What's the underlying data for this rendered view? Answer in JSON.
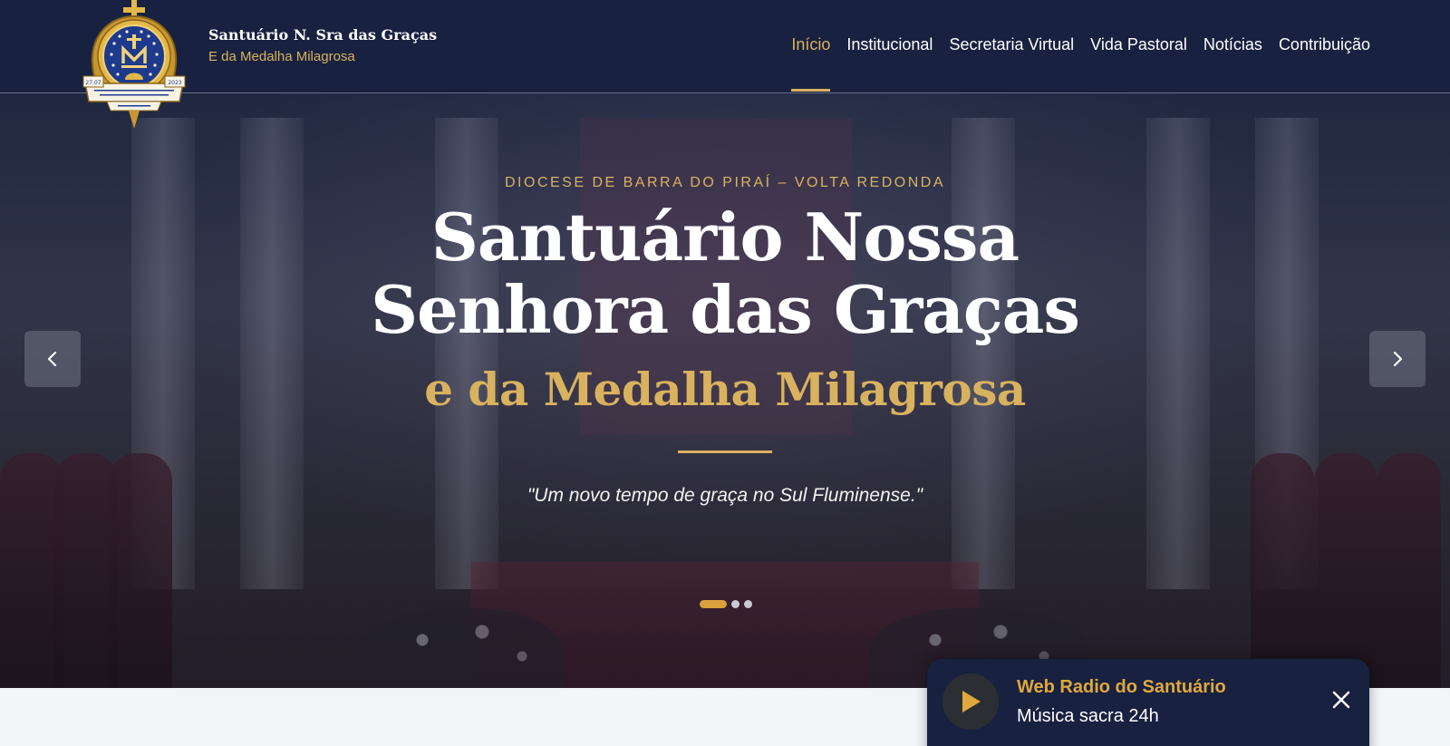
{
  "header": {
    "brand_title": "Santuário N. Sra das Graças",
    "brand_subtitle": "E da Medalha Milagrosa",
    "logo": {
      "icon": "santuario-crest-logo",
      "year_left": "27.07",
      "year_right": "2023",
      "ribbon_text": "SANTUÁRIO NOSSA SENHORA DAS GRAÇAS E DA MEDALHA MILAGROSA",
      "place_text": "VOLTA REDONDA · RJ"
    },
    "nav": [
      {
        "label": "Início",
        "active": true
      },
      {
        "label": "Institucional",
        "active": false
      },
      {
        "label": "Secretaria Virtual",
        "active": false
      },
      {
        "label": "Vida Pastoral",
        "active": false
      },
      {
        "label": "Notícias",
        "active": false
      },
      {
        "label": "Contribuição",
        "active": false
      }
    ]
  },
  "hero": {
    "eyebrow": "DIOCESE DE BARRA DO PIRAÍ – VOLTA REDONDA",
    "title": "Santuário Nossa Senhora das Graças",
    "subtitle": "e da Medalha Milagrosa",
    "quote": "\"Um novo tempo de graça no Sul Fluminense.\"",
    "slides_total": 3,
    "active_slide": 1,
    "prev_icon": "chevron-left-icon",
    "next_icon": "chevron-right-icon"
  },
  "radio": {
    "title": "Web Radio do Santuário",
    "subtitle": "Música sacra 24h",
    "play_icon": "play-icon",
    "close_icon": "close-icon"
  },
  "colors": {
    "navy": "#18213f",
    "gold": "#d9b25f",
    "accent_orange": "#e0a93c",
    "white": "#ffffff"
  }
}
